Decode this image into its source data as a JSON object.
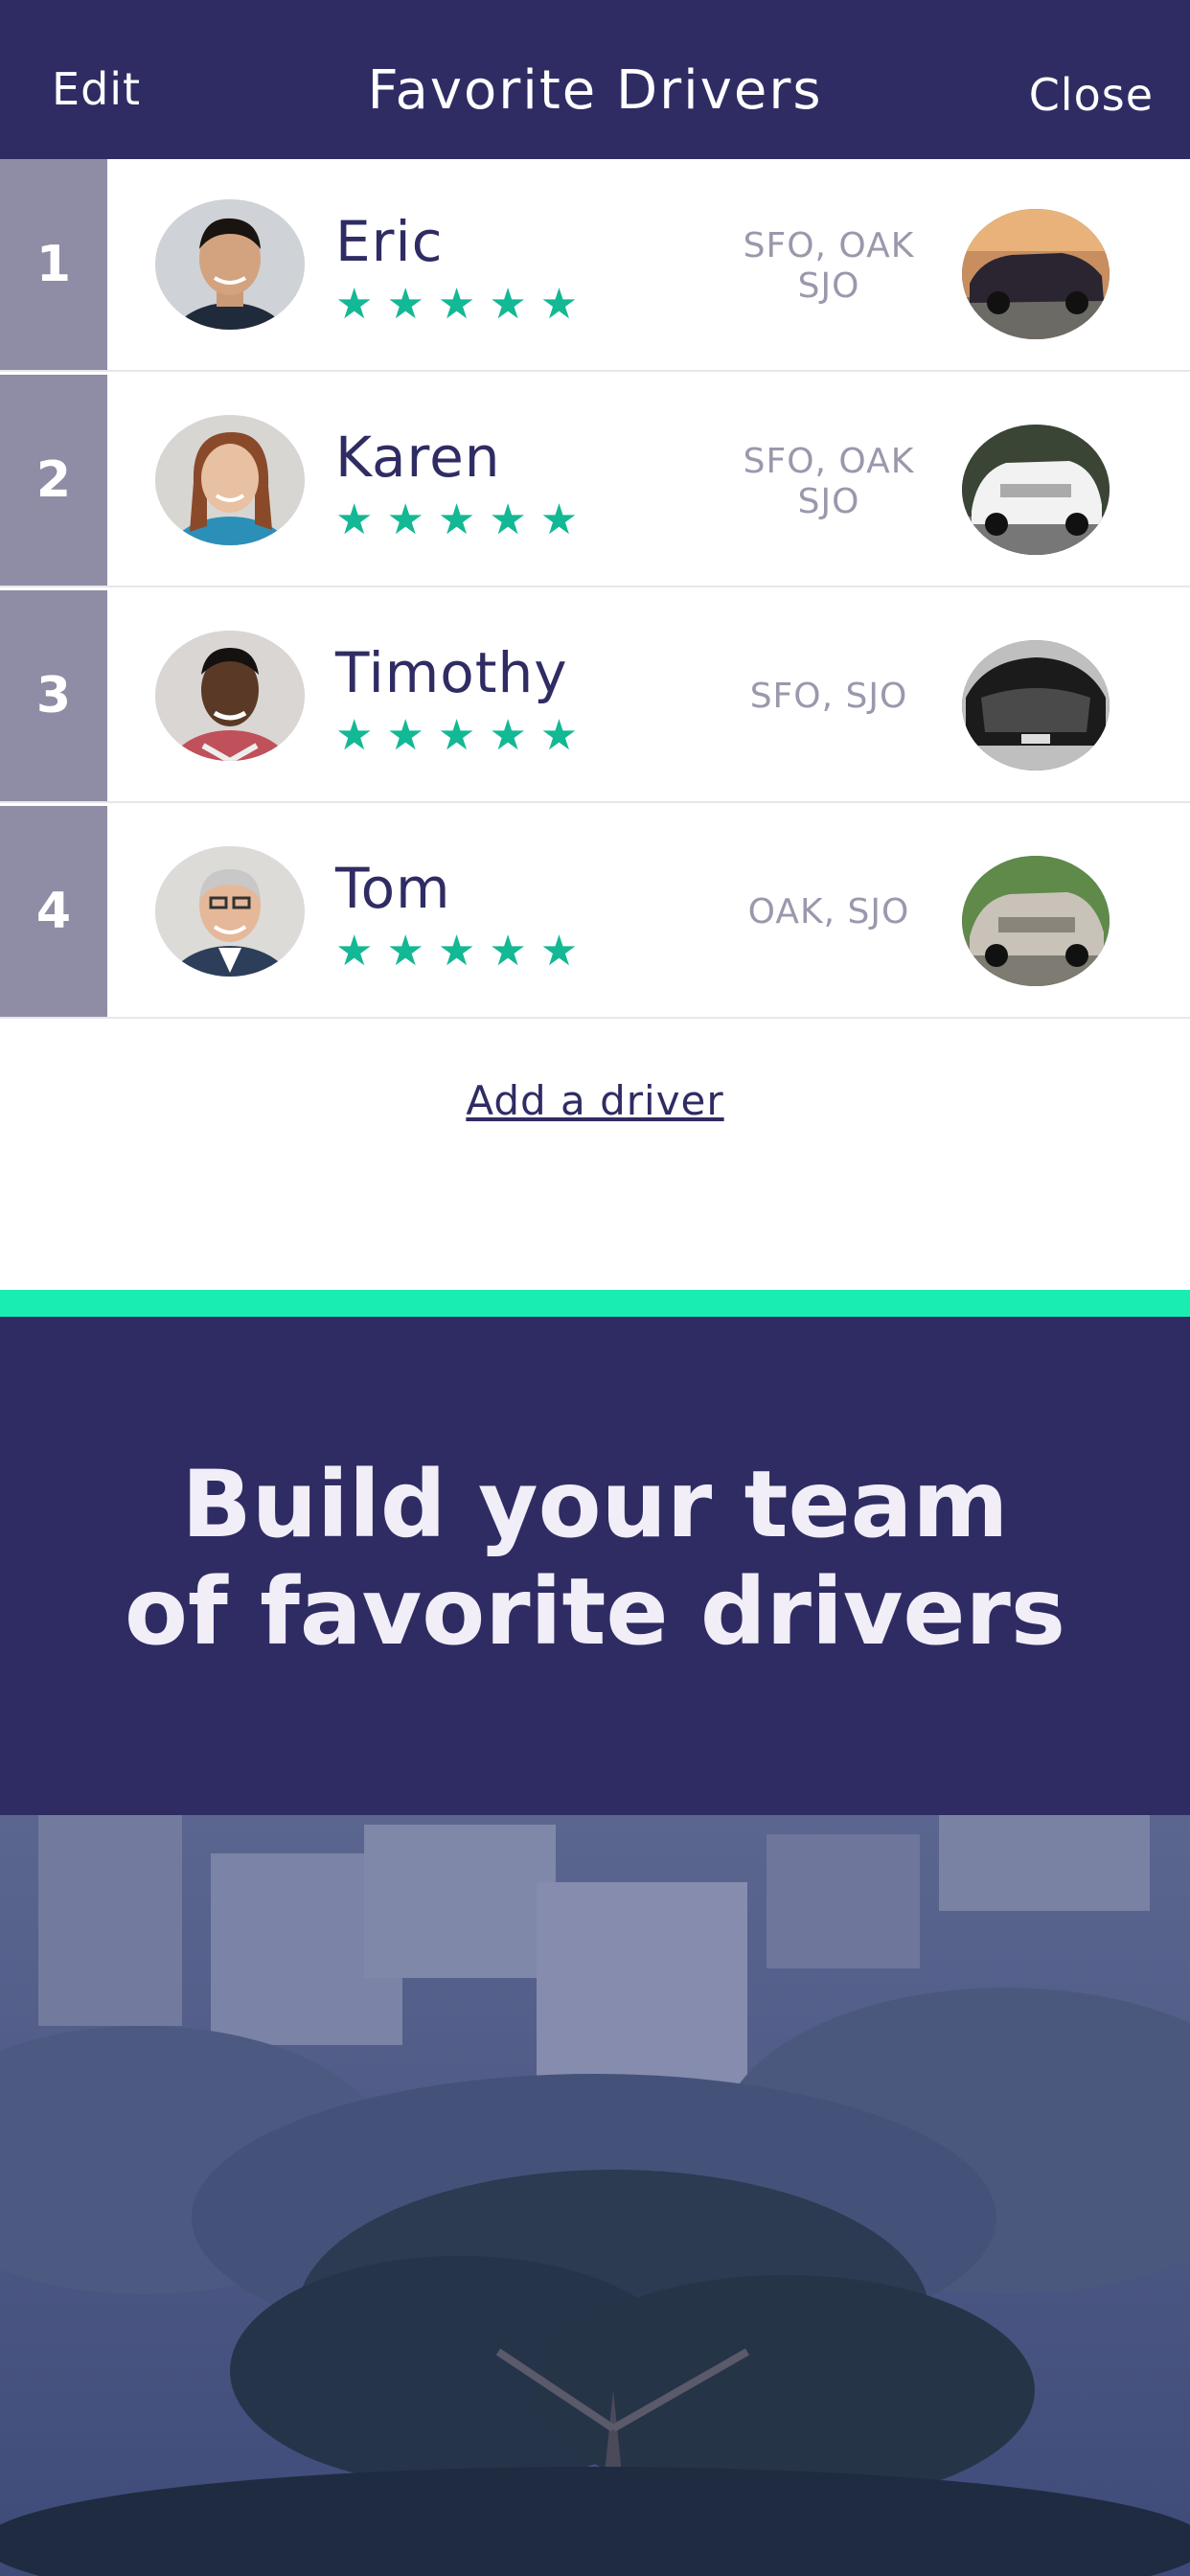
{
  "header": {
    "edit_label": "Edit",
    "title": "Favorite Drivers",
    "close_label": "Close"
  },
  "drivers": [
    {
      "rank": "1",
      "name": "Eric",
      "stars": "★★★★★",
      "airports_line1": "SFO, OAK",
      "airports_line2": "SJO",
      "car_color": "#2a2530"
    },
    {
      "rank": "2",
      "name": "Karen",
      "stars": "★★★★★",
      "airports_line1": "SFO, OAK",
      "airports_line2": "SJO",
      "car_color": "#f2f2f2"
    },
    {
      "rank": "3",
      "name": "Timothy",
      "stars": "★★★★★",
      "airports_line1": "SFO, SJO",
      "airports_line2": "",
      "car_color": "#1b1b1b"
    },
    {
      "rank": "4",
      "name": "Tom",
      "stars": "★★★★★",
      "airports_line1": "OAK, SJO",
      "airports_line2": "",
      "car_color": "#c8c2b8"
    }
  ],
  "add_driver_label": "Add a driver",
  "promo": {
    "line1": "Build your team",
    "line2": "of favorite drivers"
  },
  "colors": {
    "primary": "#2f2c64",
    "accent": "#19edb2",
    "star": "#13b894",
    "rank_bg": "#8f8ca6"
  }
}
